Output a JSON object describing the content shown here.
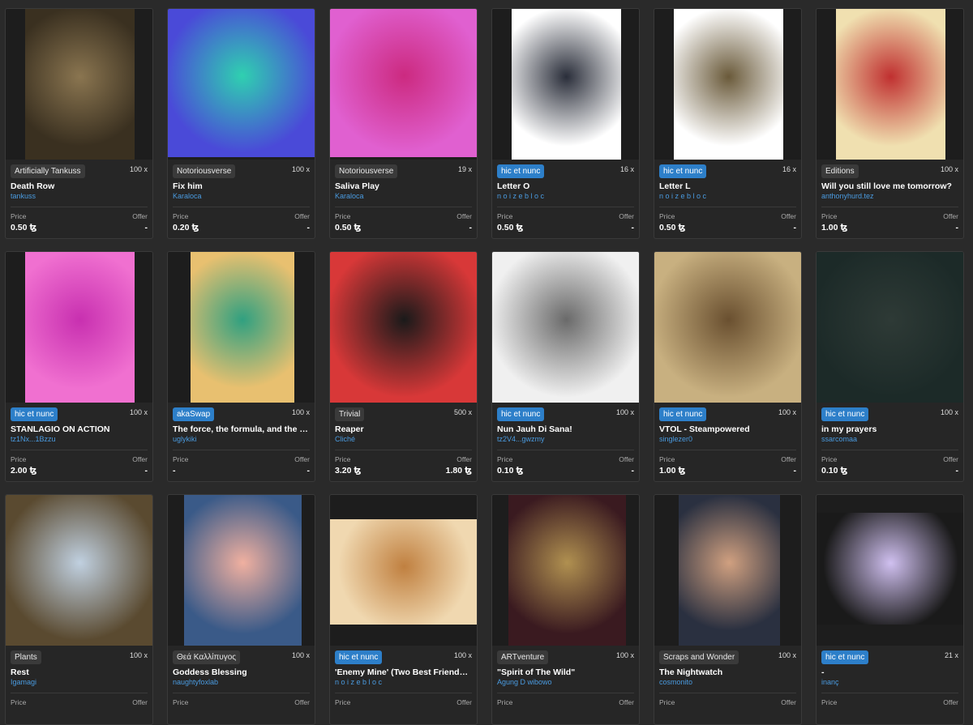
{
  "currency_symbol": "ꜩ",
  "labels": {
    "price": "Price",
    "offer": "Offer",
    "editions_suffix": "x"
  },
  "cards": [
    {
      "tag": "Artificially Tankuss",
      "tag_style": "plain",
      "editions": "100",
      "title": "Death Row",
      "creator": "tankuss",
      "price": "0.50 ꜩ",
      "offer": "-",
      "art_colors": [
        "#3a3020",
        "#8a7550"
      ]
    },
    {
      "tag": "Notoriousverse",
      "tag_style": "plain",
      "editions": "100",
      "title": "Fix him",
      "creator": "Karaloca",
      "price": "0.20 ꜩ",
      "offer": "-",
      "art_colors": [
        "#4a4ad8",
        "#2fd0b0"
      ]
    },
    {
      "tag": "Notoriousverse",
      "tag_style": "plain",
      "editions": "19",
      "title": "Saliva Play",
      "creator": "Karaloca",
      "price": "0.50 ꜩ",
      "offer": "-",
      "art_colors": [
        "#e060d0",
        "#cc2a80"
      ]
    },
    {
      "tag": "hic et nunc",
      "tag_style": "blue",
      "editions": "16",
      "title": "Letter O",
      "creator": "n o i z e b l o c",
      "price": "0.50 ꜩ",
      "offer": "-",
      "art_colors": [
        "#ffffff",
        "#2a2e3a"
      ]
    },
    {
      "tag": "hic et nunc",
      "tag_style": "blue",
      "editions": "16",
      "title": "Letter L",
      "creator": "n o i z e b l o c",
      "price": "0.50 ꜩ",
      "offer": "-",
      "art_colors": [
        "#ffffff",
        "#6a5a3a"
      ]
    },
    {
      "tag": "Editions",
      "tag_style": "plain",
      "editions": "100",
      "title": "Will you still love me tomorrow?",
      "creator": "anthonyhurd.tez",
      "price": "1.00 ꜩ",
      "offer": "-",
      "art_colors": [
        "#f0e0b0",
        "#c03030"
      ]
    },
    {
      "tag": "hic et nunc",
      "tag_style": "blue",
      "editions": "100",
      "title": "STANLAGIO ON ACTION",
      "creator": "tz1Nx...1Bzzu",
      "price": "2.00 ꜩ",
      "offer": "-",
      "art_colors": [
        "#f070d0",
        "#c830b0"
      ]
    },
    {
      "tag": "akaSwap",
      "tag_style": "blue",
      "editions": "100",
      "title": "The force, the formula, and the fo...",
      "creator": "uglykiki",
      "price": "-",
      "offer": "-",
      "art_colors": [
        "#e8c070",
        "#30a080"
      ]
    },
    {
      "tag": "Trivial",
      "tag_style": "plain",
      "editions": "500",
      "title": "Reaper",
      "creator": "Cliché",
      "price": "3.20 ꜩ",
      "offer": "1.80 ꜩ",
      "art_colors": [
        "#d83838",
        "#1a1a1a"
      ]
    },
    {
      "tag": "hic et nunc",
      "tag_style": "blue",
      "editions": "100",
      "title": "Nun Jauh Di Sana!",
      "creator": "tz2V4...gwzmy",
      "price": "0.10 ꜩ",
      "offer": "-",
      "art_colors": [
        "#f0f0f0",
        "#6a6a6a"
      ]
    },
    {
      "tag": "hic et nunc",
      "tag_style": "blue",
      "editions": "100",
      "title": "VTOL - Steampowered",
      "creator": "singlezer0",
      "price": "1.00 ꜩ",
      "offer": "-",
      "art_colors": [
        "#c8b080",
        "#6a5030"
      ]
    },
    {
      "tag": "hic et nunc",
      "tag_style": "blue",
      "editions": "100",
      "title": "in my prayers",
      "creator": "ssarcomaa",
      "price": "0.10 ꜩ",
      "offer": "-",
      "art_colors": [
        "#1c2a28",
        "#2e3a36"
      ]
    },
    {
      "tag": "Plants",
      "tag_style": "plain",
      "editions": "100",
      "title": "Rest",
      "creator": "Igamagi",
      "price": "",
      "offer": "",
      "art_colors": [
        "#5a4a30",
        "#c0d0e0"
      ]
    },
    {
      "tag": "Θεά Καλλίπυγος",
      "tag_style": "plain",
      "editions": "100",
      "title": "Goddess Blessing",
      "creator": "naughtyfoxlab",
      "price": "",
      "offer": "",
      "art_colors": [
        "#3a5a88",
        "#f0b0a0"
      ]
    },
    {
      "tag": "hic et nunc",
      "tag_style": "blue",
      "editions": "100",
      "title": "'Enemy Mine' (Two Best Friends B...",
      "creator": "n o i z e b l o c",
      "price": "",
      "offer": "",
      "art_colors": [
        "#f0d8b0",
        "#c08040"
      ]
    },
    {
      "tag": "ARTventure",
      "tag_style": "plain",
      "editions": "100",
      "title": "\"Spirit of The Wild\"",
      "creator": "Agung D wibowo",
      "price": "",
      "offer": "",
      "art_colors": [
        "#3a1a20",
        "#b09050"
      ]
    },
    {
      "tag": "Scraps and Wonder",
      "tag_style": "plain",
      "editions": "100",
      "title": "The Nightwatch",
      "creator": "cosmonito",
      "price": "",
      "offer": "",
      "art_colors": [
        "#2a3040",
        "#d0a080"
      ]
    },
    {
      "tag": "hic et nunc",
      "tag_style": "blue",
      "editions": "21",
      "title": "-",
      "creator": "inanç",
      "price": "",
      "offer": "",
      "art_colors": [
        "#1a1a1a",
        "#d0c0f0"
      ]
    }
  ]
}
